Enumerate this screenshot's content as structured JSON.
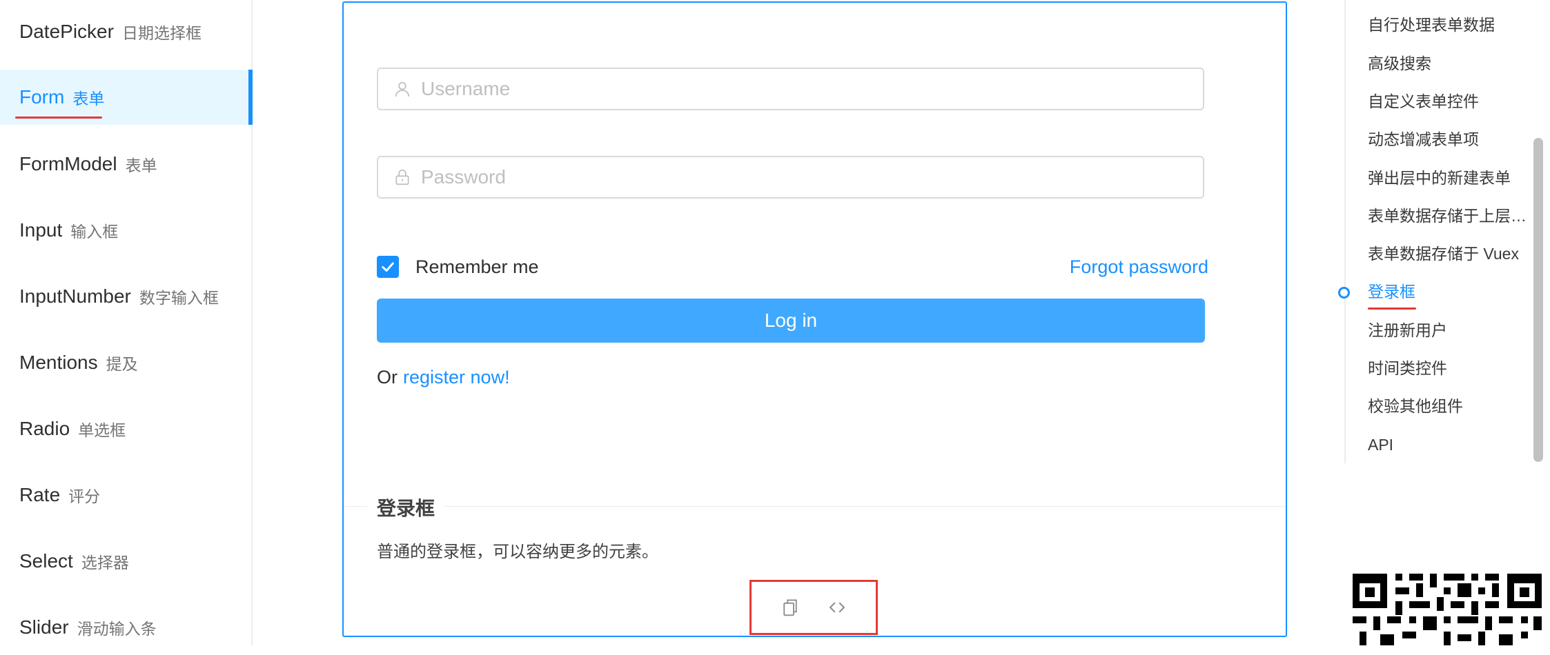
{
  "sidebar": {
    "items": [
      {
        "en": "DatePicker",
        "zh": "日期选择框"
      },
      {
        "en": "Form",
        "zh": "表单"
      },
      {
        "en": "FormModel",
        "zh": "表单"
      },
      {
        "en": "Input",
        "zh": "输入框"
      },
      {
        "en": "InputNumber",
        "zh": "数字输入框"
      },
      {
        "en": "Mentions",
        "zh": "提及"
      },
      {
        "en": "Radio",
        "zh": "单选框"
      },
      {
        "en": "Rate",
        "zh": "评分"
      },
      {
        "en": "Select",
        "zh": "选择器"
      },
      {
        "en": "Slider",
        "zh": "滑动输入条"
      }
    ],
    "active_index": 1
  },
  "demo": {
    "username_placeholder": "Username",
    "password_placeholder": "Password",
    "remember_label": "Remember me",
    "remember_checked": true,
    "forgot_label": "Forgot password",
    "login_label": "Log in",
    "or_text": "Or",
    "register_label": "register now!",
    "meta_title": "登录框",
    "meta_desc": "普通的登录框，可以容纳更多的元素。"
  },
  "anchor": {
    "items": [
      "自行处理表单数据",
      "高级搜索",
      "自定义表单控件",
      "动态增减表单项",
      "弹出层中的新建表单",
      "表单数据存储于上层组件",
      "表单数据存储于 Vuex",
      "登录框",
      "注册新用户",
      "时间类控件",
      "校验其他组件",
      "API"
    ],
    "active_index": 7
  },
  "icons": {
    "username": "user-icon",
    "password": "lock-icon",
    "copy": "copy-icon",
    "code": "code-expand-icon"
  },
  "colors": {
    "primary": "#1890ff",
    "login_button": "#40a9ff",
    "highlight_underline": "#e53935"
  }
}
